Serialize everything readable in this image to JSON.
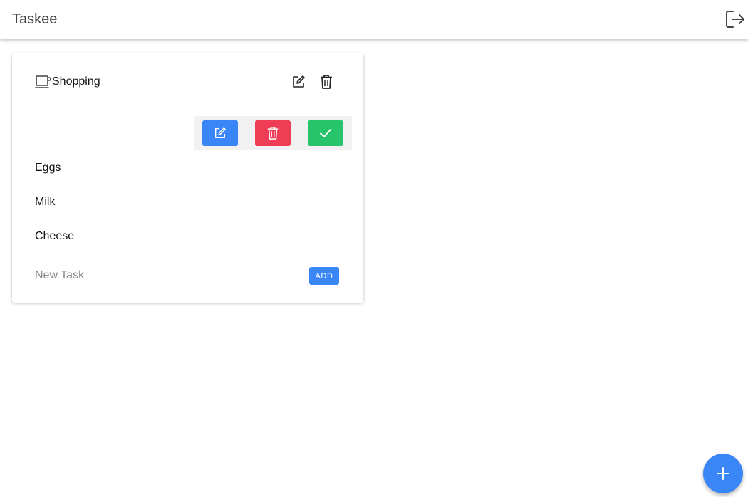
{
  "app": {
    "title": "Taskee",
    "logout_icon": "logout-icon"
  },
  "list": {
    "title": "Shopping",
    "icon": "coffee-cup-icon",
    "edit_icon": "edit-icon",
    "delete_icon": "trash-icon"
  },
  "actions": {
    "edit_icon": "edit-icon",
    "delete_icon": "trash-icon",
    "done_icon": "check-icon",
    "colors": {
      "edit": "#3a86f7",
      "delete": "#ef3d55",
      "done": "#27c46b"
    }
  },
  "tasks": [
    {
      "label": "Eggs"
    },
    {
      "label": "Milk"
    },
    {
      "label": "Cheese"
    }
  ],
  "new_task": {
    "placeholder": "New Task",
    "value": "",
    "add_label": "ADD"
  },
  "fab": {
    "icon": "plus-icon"
  },
  "theme": {
    "accent": "#3a86f7"
  }
}
